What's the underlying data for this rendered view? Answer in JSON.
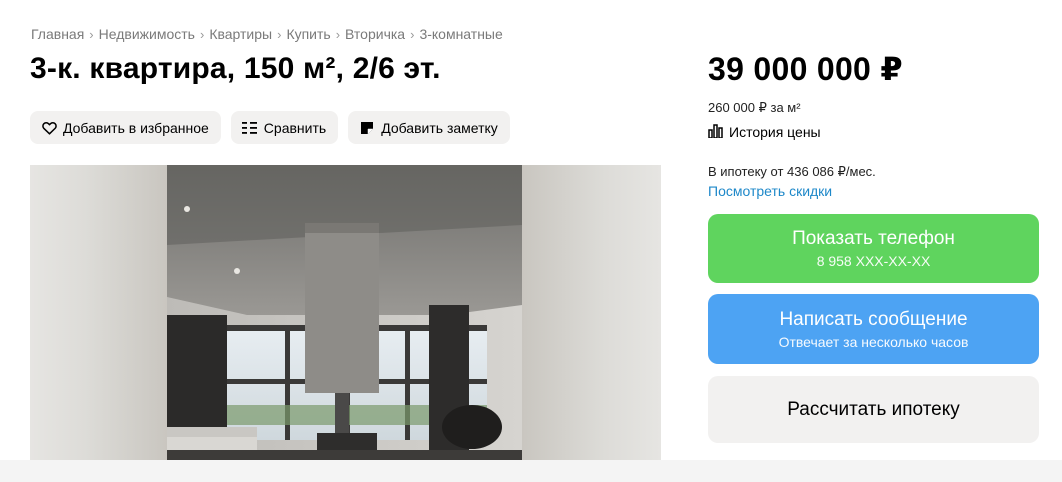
{
  "breadcrumb": [
    "Главная",
    "Недвижимость",
    "Квартиры",
    "Купить",
    "Вторичка",
    "3-комнатные"
  ],
  "title": "3-к. квартира, 150 м², 2/6 эт.",
  "actions": {
    "favorite_label": "Добавить в избранное",
    "compare_label": "Сравнить",
    "note_label": "Добавить заметку"
  },
  "price": {
    "total": "39 000 000 ₽",
    "per_meter": "260 000 ₽ за м²",
    "history_label": "История цены"
  },
  "mortgage": {
    "text": "В ипотеку от 436 086 ₽/мес.",
    "discounts_link": "Посмотреть скидки"
  },
  "contact": {
    "phone_button": "Показать телефон",
    "phone_masked": "8 958 XXX-XX-XX",
    "message_button": "Написать сообщение",
    "message_sub": "Отвечает за несколько часов",
    "mortgage_button": "Рассчитать ипотеку"
  },
  "colors": {
    "phone_green": "#5fd45e",
    "message_blue": "#4da3f3",
    "link_blue": "#1e88c9",
    "pill_bg": "#f2f1f0"
  },
  "icons": {
    "favorite": "heart-icon",
    "compare": "compare-icon",
    "note": "note-icon",
    "history": "bar-chart-icon"
  }
}
